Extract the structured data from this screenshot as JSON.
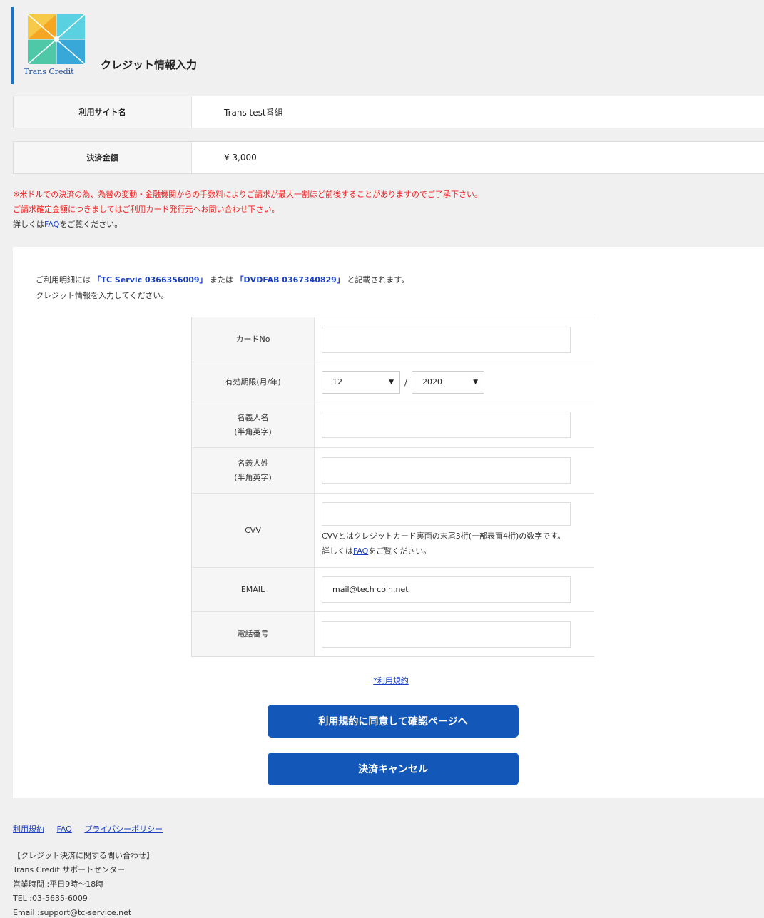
{
  "header": {
    "logo_text": "Trans Credit",
    "title": "クレジット情報入力"
  },
  "info": {
    "site_label": "利用サイト名",
    "site_value": "Trans test番組",
    "amount_label": "決済金額",
    "amount_value": "¥ 3,000"
  },
  "notice": {
    "line1": "※米ドルでの決済の為、為替の変動・金融機関からの手数料によりご請求が最大一割ほど前後することがありますのでご了承下さい。",
    "line2": "ご請求確定金額につきましてはご利用カード発行元へお問い合わせ下さい。",
    "line3_pre": "詳しくは",
    "line3_link": "FAQ",
    "line3_post": "をご覧ください。"
  },
  "intro": {
    "pre": "ご利用明細には",
    "name1": "「TC Servic 0366356009」",
    "mid": "または",
    "name2": "「DVDFAB 0367340829」",
    "post": "と記載されます。",
    "line2": "クレジット情報を入力してください。"
  },
  "form": {
    "card_label": "カードNo",
    "card_value": "",
    "expiry_label": "有効期限(月/年)",
    "month_value": "12",
    "slash": "/",
    "year_value": "2020",
    "first_name_label1": "名義人名",
    "first_name_label2": "(半角英字)",
    "last_name_label1": "名義人姓",
    "last_name_label2": "(半角英字)",
    "cvv_label": "CVV",
    "cvv_note_pre": "CVVとはクレジットカード裏面の末尾3桁(一部表面4桁)の数字です。詳しくは",
    "cvv_note_link": "FAQ",
    "cvv_note_post": "をご覧ください。",
    "email_label": "EMAIL",
    "email_value": "mail@tech coin.net",
    "phone_label": "電話番号"
  },
  "terms_link": "*利用規約",
  "buttons": {
    "confirm": "利用規約に同意して確認ページへ",
    "cancel": "決済キャンセル"
  },
  "footer": {
    "links": [
      "利用規約",
      "FAQ",
      "プライバシーポリシー"
    ],
    "info": [
      "【クレジット決済に関する問い合わせ】",
      "Trans Credit サポートセンター",
      "営業時間 :平日9時～18時",
      "TEL :03-5635-6009",
      "Email :support@tc-service.net"
    ]
  },
  "colors": {
    "primary_button": "#1358b8",
    "notice_red": "#e22",
    "link_blue": "#1a3fbf"
  }
}
